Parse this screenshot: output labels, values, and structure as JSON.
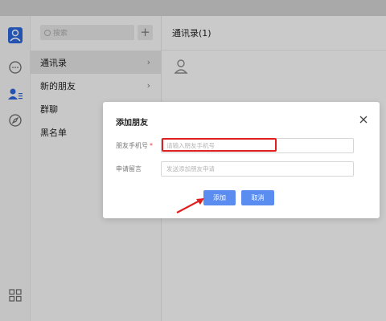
{
  "search": {
    "placeholder": "搜索"
  },
  "sidebar": {
    "items": [
      {
        "label": "通讯录",
        "active": true,
        "has_chevron": true
      },
      {
        "label": "新的朋友",
        "active": false,
        "has_chevron": true
      },
      {
        "label": "群聊",
        "active": false,
        "has_chevron": false
      },
      {
        "label": "黑名单",
        "active": false,
        "has_chevron": false
      }
    ],
    "chevron": "›"
  },
  "main": {
    "title": "通讯录(1)"
  },
  "dialog": {
    "title": "添加朋友",
    "close_icon": "×",
    "phone": {
      "label": "朋友手机号",
      "required_mark": "*",
      "placeholder": "请输入朋友手机号",
      "value": ""
    },
    "message": {
      "label": "申请留言",
      "placeholder": "发送添加朋友申请",
      "value": ""
    },
    "add_label": "添加",
    "cancel_label": "取消"
  },
  "colors": {
    "accent": "#5b8df0",
    "highlight": "#e02020",
    "left_icons_active": "#2b64d8"
  },
  "icons": [
    "avatar-icon",
    "chat-bubble-icon",
    "contacts-icon",
    "compass-icon",
    "grid-icon",
    "search-icon",
    "plus-icon",
    "close-icon",
    "arrow-annotation"
  ]
}
